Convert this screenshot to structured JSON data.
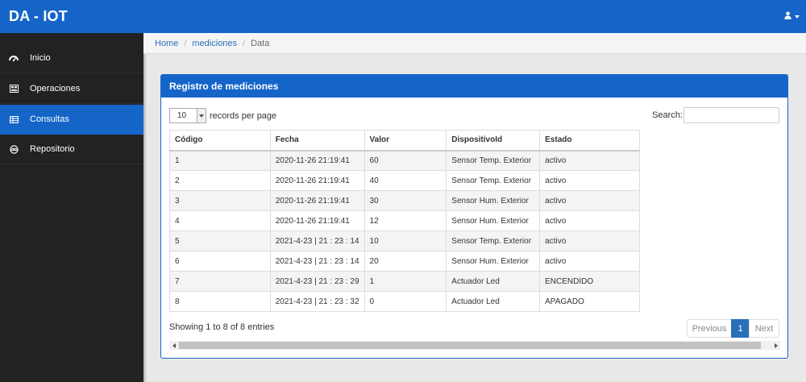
{
  "app": {
    "brand": "DA - IOT"
  },
  "header": {
    "user_icon": "user-icon"
  },
  "sidebar": {
    "items": [
      {
        "label": "Inicio",
        "icon": "dashboard-icon",
        "active": false
      },
      {
        "label": "Operaciones",
        "icon": "operations-icon",
        "active": false
      },
      {
        "label": "Consultas",
        "icon": "table-icon",
        "active": true
      },
      {
        "label": "Repositorio",
        "icon": "repository-icon",
        "active": false
      }
    ]
  },
  "breadcrumb": {
    "items": [
      "Home",
      "mediciones",
      "Data"
    ]
  },
  "panel": {
    "title": "Registro de mediciones"
  },
  "table_controls": {
    "page_length": "10",
    "records_per_page_label": "records per page",
    "search_label": "Search:",
    "search_value": ""
  },
  "table": {
    "columns": [
      "Código",
      "Fecha",
      "Valor",
      "DispositivoId",
      "Estado"
    ],
    "rows": [
      [
        "1",
        "2020-11-26 21:19:41",
        "60",
        "Sensor Temp. Exterior",
        "activo"
      ],
      [
        "2",
        "2020-11-26 21:19:41",
        "40",
        "Sensor Temp. Exterior",
        "activo"
      ],
      [
        "3",
        "2020-11-26 21:19:41",
        "30",
        "Sensor Hum. Exterior",
        "activo"
      ],
      [
        "4",
        "2020-11-26 21:19:41",
        "12",
        "Sensor Hum. Exterior",
        "activo"
      ],
      [
        "5",
        "2021-4-23 | 21 : 23 : 14",
        "10",
        "Sensor Temp. Exterior",
        "activo"
      ],
      [
        "6",
        "2021-4-23 | 21 : 23 : 14",
        "20",
        "Sensor Hum. Exterior",
        "activo"
      ],
      [
        "7",
        "2021-4-23 | 21 : 23 : 29",
        "1",
        "Actuador Led",
        "ENCENDIDO"
      ],
      [
        "8",
        "2021-4-23 | 21 : 23 : 32",
        "0",
        "Actuador Led",
        "APAGADO"
      ]
    ]
  },
  "footer": {
    "info": "Showing 1 to 8 of 8 entries",
    "previous_label": "Previous",
    "current_page": "1",
    "next_label": "Next"
  },
  "colors": {
    "primary": "#1565c9",
    "sidebar_bg": "#222222",
    "link": "#2a6fb8"
  }
}
